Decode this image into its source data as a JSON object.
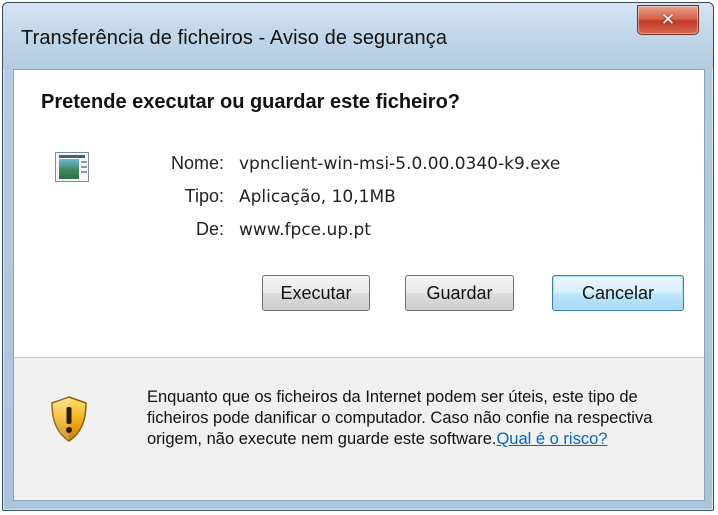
{
  "window": {
    "title": "Transferência de ficheiros - Aviso de segurança",
    "close_icon": "close-icon"
  },
  "dialog": {
    "heading": "Pretende executar ou guardar este ficheiro?",
    "file_icon": "application-file-icon",
    "fields": [
      {
        "label": "Nome:",
        "value": "vpnclient-win-msi-5.0.00.0340-k9.exe"
      },
      {
        "label": "Tipo:",
        "value": "Aplicação, 10,1MB"
      },
      {
        "label": "De:",
        "value": "www.fpce.up.pt"
      }
    ],
    "buttons": {
      "run": "Executar",
      "save": "Guardar",
      "cancel": "Cancelar"
    }
  },
  "warning": {
    "icon": "security-shield-icon",
    "text": "Enquanto que os ficheiros da Internet podem ser úteis, este tipo de ficheiros pode danificar o computador. Caso não confie na respectiva origem, não execute nem guarde este software.",
    "link": "Qual é o risco?"
  },
  "colors": {
    "link": "#0066cc",
    "shield": "#e8a80c",
    "close_button": "#c2392a"
  }
}
